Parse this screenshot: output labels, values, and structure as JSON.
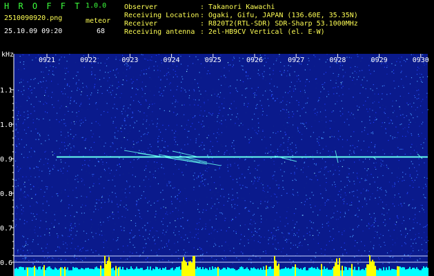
{
  "app": {
    "name": "H R O F F T",
    "version": "1.0.0",
    "filename": "2510090920.png",
    "datetime": "25.10.09 09:20",
    "meteor_label": "meteor",
    "meteor_count": "68"
  },
  "info": [
    {
      "label": "Observer",
      "value": ": Takanori Kawachi"
    },
    {
      "label": "Receiving Location",
      "value": ": Ogaki, Gifu, JAPAN (136.60E, 35.35N)"
    },
    {
      "label": "Receiver",
      "value": ": R820T2(RTL-SDR) SDR-Sharp 53.1000MHz"
    },
    {
      "label": "Receiving antenna",
      "value": ": 2el-HB9CV Vertical (el. E-W)"
    }
  ],
  "axis": {
    "unit": "kHz",
    "time_labels": [
      "0921",
      "0922",
      "0923",
      "0924",
      "0925",
      "0926",
      "0927",
      "0928",
      "0929",
      "0930"
    ],
    "freq_labels": [
      "1.1",
      "1.0",
      "0.9",
      "0.8",
      "0.7",
      "0.6"
    ],
    "freq_values": [
      1.1,
      1.0,
      0.9,
      0.8,
      0.7,
      0.6
    ]
  },
  "colors": {
    "background_noise": "#0a1a8c",
    "carrier": "#66ffee",
    "grid": "#ffffff",
    "level_bars": "#00ffff",
    "level_peaks": "#ffff00",
    "header_green": "#3cff3c",
    "header_yellow": "#ffff55"
  }
}
